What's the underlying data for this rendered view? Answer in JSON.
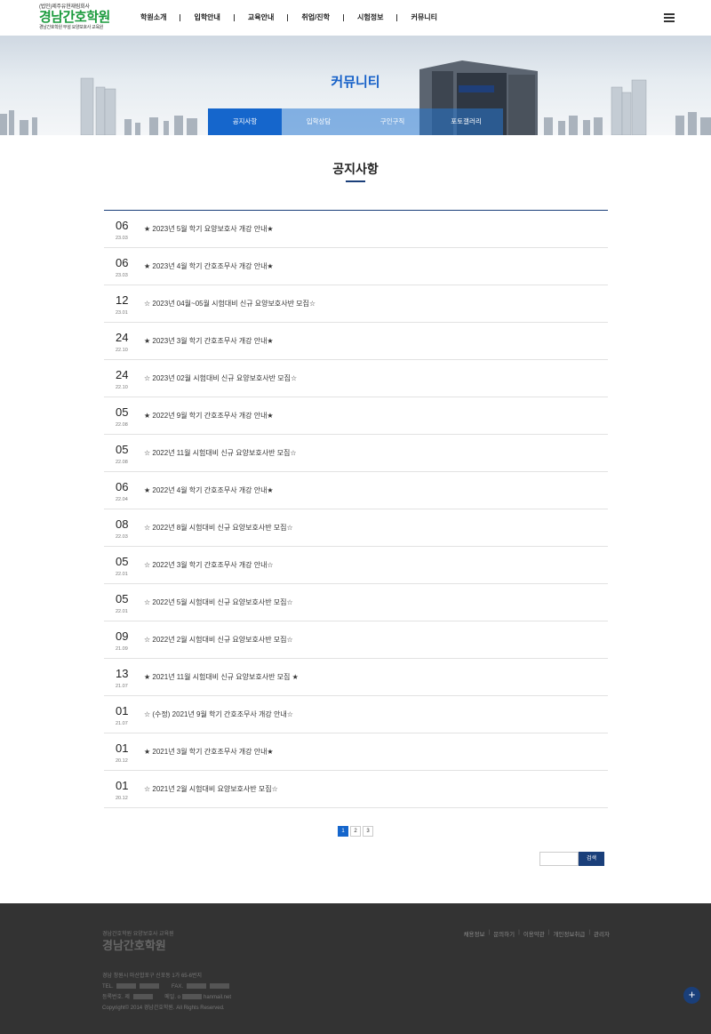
{
  "header": {
    "logo_line1": "(법인)제주유현재림회사",
    "logo_line2": "경남간호학원",
    "logo_line3": "경남간호학원 부설 요양보호사 교육원",
    "nav": [
      "학원소개",
      "입학안내",
      "교육안내",
      "취업/진학",
      "시험정보",
      "커뮤니티"
    ]
  },
  "hero": {
    "title": "커뮤니티",
    "tabs": [
      "공지사항",
      "입학상담",
      "구인구직",
      "포토갤러리"
    ]
  },
  "main": {
    "page_title": "공지사항",
    "notices": [
      {
        "day": "06",
        "ym": "23.03",
        "title": "★ 2023년 5월 학기 요양보호사 개강 안내★"
      },
      {
        "day": "06",
        "ym": "23.03",
        "title": "★ 2023년 4월 학기 간호조무사 개강 안내★"
      },
      {
        "day": "12",
        "ym": "23.01",
        "title": "☆ 2023년 04월~05월 시험대비 신규 요양보호사반 모집☆"
      },
      {
        "day": "24",
        "ym": "22.10",
        "title": "★ 2023년 3월 학기 간호조무사 개강 안내★"
      },
      {
        "day": "24",
        "ym": "22.10",
        "title": "☆ 2023년 02월 시험대비 신규 요양보호사반 모집☆"
      },
      {
        "day": "05",
        "ym": "22.08",
        "title": "★ 2022년 9월 학기 간호조무사 개강 안내★"
      },
      {
        "day": "05",
        "ym": "22.08",
        "title": "☆ 2022년 11월 시험대비 신규 요양보호사반 모집☆"
      },
      {
        "day": "06",
        "ym": "22.04",
        "title": "★ 2022년 4월 학기 간호조무사 개강 안내★"
      },
      {
        "day": "08",
        "ym": "22.03",
        "title": "☆ 2022년 8월 시험대비 신규 요양보호사반 모집☆"
      },
      {
        "day": "05",
        "ym": "22.01",
        "title": "☆ 2022년 3월 학기 간호조무사 개강 안내☆"
      },
      {
        "day": "05",
        "ym": "22.01",
        "title": "☆ 2022년 5월 시험대비 신규 요양보호사반 모집☆"
      },
      {
        "day": "09",
        "ym": "21.09",
        "title": "☆ 2022년 2월 시험대비 신규 요양보호사반 모집☆"
      },
      {
        "day": "13",
        "ym": "21.07",
        "title": "★ 2021년 11월 시험대비 신규 요양보호사반 모집 ★"
      },
      {
        "day": "01",
        "ym": "21.07",
        "title": "☆ (수정) 2021년 9월 학기 간호조무사 개강 안내☆"
      },
      {
        "day": "01",
        "ym": "20.12",
        "title": "★ 2021년 3월 학기 간호조무사 개강 안내★"
      },
      {
        "day": "01",
        "ym": "20.12",
        "title": "☆ 2021년 2월 시험대비 요양보호사반 모집☆"
      }
    ],
    "pages": [
      "1",
      "2",
      "3"
    ],
    "search_label": "검색"
  },
  "footer": {
    "small": "경남간호학원 요양보호사 교육원",
    "name": "경남간호학원",
    "links": [
      "채용정보",
      "문의하기",
      "이용약관",
      "개인정보취급",
      "관리자"
    ],
    "address": "경남 창원시 마산합포구 신포동 1가 65-6번지",
    "tel_label": "TEL.",
    "fax_label": "FAX.",
    "biz_label": "등록번호. 제",
    "mail_label": "메일. o",
    "mail_domain": "hanmail.net",
    "copyright": "Copyright© 2014 경남간호학원. All Rights Reserved."
  },
  "colors": {
    "accent": "#1566cc",
    "navy": "#1a3f7a",
    "logo_green": "#1a9a3c"
  }
}
